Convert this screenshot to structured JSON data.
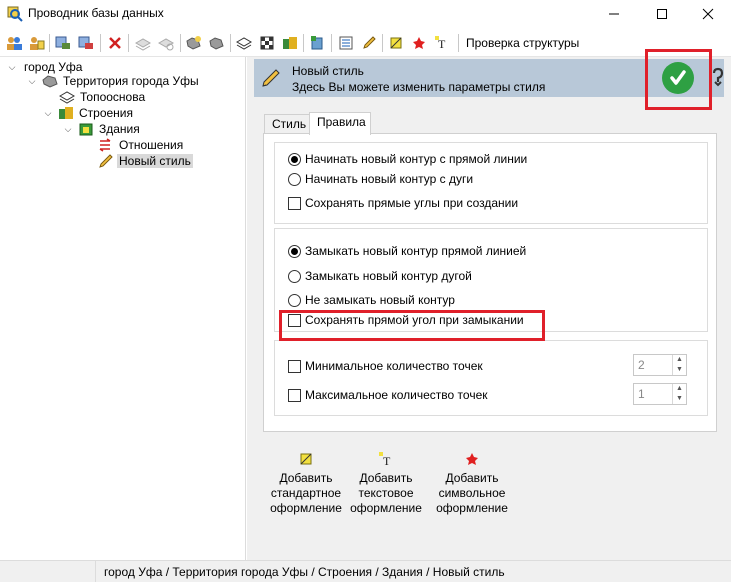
{
  "window": {
    "title": "Проводник базы данных",
    "icon": "search-db-icon"
  },
  "toolbar": {
    "structure_check_label": "Проверка структуры"
  },
  "tree": {
    "items": [
      {
        "label": "город Уфа",
        "icon": "none"
      },
      {
        "label": "Территория города Уфы",
        "icon": "territory-icon"
      },
      {
        "label": "Топооснова",
        "icon": "layers-icon"
      },
      {
        "label": "Строения",
        "icon": "buildings-icon"
      },
      {
        "label": "Здания",
        "icon": "building-icon"
      },
      {
        "label": "Отношения",
        "icon": "relations-icon"
      },
      {
        "label": "Новый стиль",
        "icon": "pencil-icon"
      }
    ]
  },
  "header": {
    "title": "Новый стиль",
    "subtitle": "Здесь Вы можете изменить параметры стиля"
  },
  "tabs": [
    {
      "label": "Стиль"
    },
    {
      "label": "Правила"
    }
  ],
  "rules": {
    "start_line": "Начинать новый контур с прямой линии",
    "start_arc": "Начинать новый контур с дуги",
    "keep_right_angles": "Сохранять прямые углы при создании",
    "close_line": "Замыкать новый контур прямой линией",
    "close_arc": "Замыкать новый контур дугой",
    "no_close": "Не замыкать новый контур",
    "keep_right_angle_close": "Сохранять прямой угол при замыкании",
    "min_points_label": "Минимальное количество точек",
    "min_points_value": "2",
    "max_points_label": "Максимальное количество точек",
    "max_points_value": "1"
  },
  "add_buttons": [
    {
      "line1": "Добавить",
      "line2": "стандартное",
      "line3": "оформление"
    },
    {
      "line1": "Добавить",
      "line2": "текстовое",
      "line3": "оформление"
    },
    {
      "line1": "Добавить",
      "line2": "символьное",
      "line3": "оформление"
    }
  ],
  "status": {
    "path": "город Уфа / Территория города Уфы / Строения / Здания / Новый стиль"
  },
  "colors": {
    "header_band": "#b8c8d8",
    "highlight": "#e0202a",
    "apply": "#2ea043"
  }
}
